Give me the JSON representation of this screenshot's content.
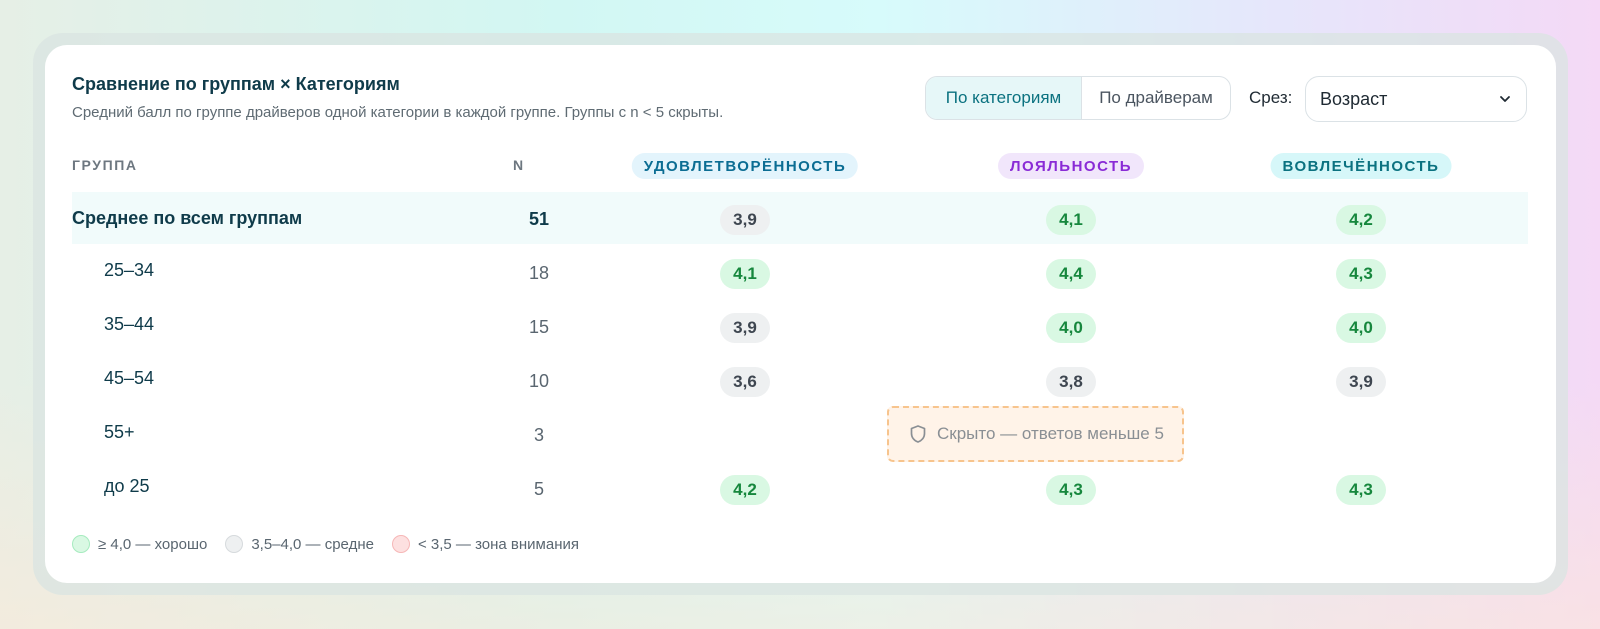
{
  "header": {
    "title": "Сравнение по группам × Категориям",
    "subtitle": "Средний балл по группе драйверов одной категории в каждой группе. Группы с n < 5 скрыты."
  },
  "view_toggle": {
    "options": [
      "По категориям",
      "По драйверам"
    ],
    "selected": "По категориям"
  },
  "slice": {
    "label": "Срез:",
    "value": "Возраст"
  },
  "table": {
    "columns": {
      "group": "ГРУППА",
      "n": "N",
      "cat1": "УДОВЛЕТВОРЁННОСТЬ",
      "cat2": "ЛОЯЛЬНОСТЬ",
      "cat3": "ВОВЛЕЧЁННОСТЬ"
    },
    "rows": [
      {
        "group": "Среднее по всем группам",
        "n": "51",
        "cat1": "3,9",
        "cat2": "4,1",
        "cat3": "4,2"
      },
      {
        "group": "25–34",
        "n": "18",
        "cat1": "4,1",
        "cat2": "4,4",
        "cat3": "4,3"
      },
      {
        "group": "35–44",
        "n": "15",
        "cat1": "3,9",
        "cat2": "4,0",
        "cat3": "4,0"
      },
      {
        "group": "45–54",
        "n": "10",
        "cat1": "3,6",
        "cat2": "3,8",
        "cat3": "3,9"
      },
      {
        "group": "55+",
        "n": "3",
        "hidden_text": "Скрыто — ответов меньше 5"
      },
      {
        "group": "до 25",
        "n": "5",
        "cat1": "4,2",
        "cat2": "4,3",
        "cat3": "4,3"
      }
    ]
  },
  "legend": [
    {
      "label": "≥ 4,0 — хорошо",
      "color": "#d9f8e3"
    },
    {
      "label": "3,5–4,0 — средне",
      "color": "#eef0f1"
    },
    {
      "label": "< 3,5 — зона внимания",
      "color": "#fde0e0"
    }
  ],
  "colors": {
    "accent": "#0b7280",
    "good_bg": "#d9f8e3",
    "good_text": "#16873d",
    "mid_bg": "#eef0f1",
    "attention_bg": "#fde0e0",
    "cat1_pill": "#e3f4fc",
    "cat2_pill": "#f1e6fb",
    "cat3_pill": "#d6f7f9"
  }
}
